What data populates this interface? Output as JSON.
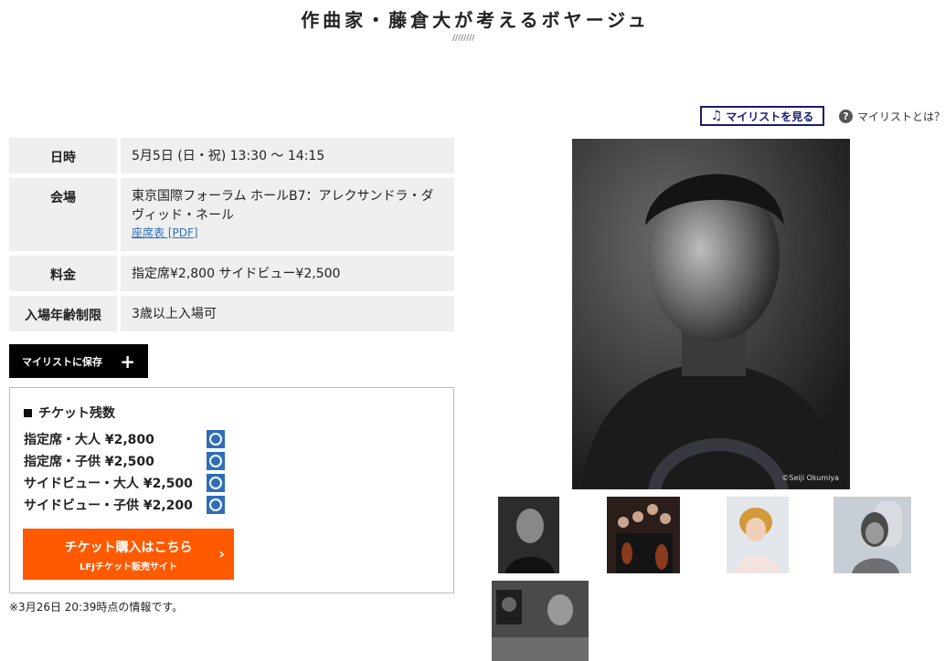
{
  "page": {
    "title": "作曲家・藤倉大が考えるボヤージュ",
    "title_deco": "////////"
  },
  "mylist": {
    "view_label": "マイリストを見る",
    "help_label": "マイリストとは？",
    "help_glyph": "?"
  },
  "info": {
    "date": {
      "label": "日時",
      "value": "5月5日 (日・祝) 13:30 〜 14:15"
    },
    "venue": {
      "label": "会場",
      "value": "東京国際フォーラム ホールB7：アレクサンドラ・ダヴィッド・ネール",
      "link": "座席表 [PDF]"
    },
    "price": {
      "label": "料金",
      "value": "指定席¥2,800 サイドビュー¥2,500"
    },
    "age": {
      "label": "入場年齢制限",
      "value": "3歳以上入場可"
    }
  },
  "save_button": {
    "label": "マイリストに保存",
    "icon": "plus-icon"
  },
  "tickets": {
    "heading": "チケット残数",
    "items": [
      {
        "name": "指定席・大人 ¥2,800"
      },
      {
        "name": "指定席・子供 ¥2,500"
      },
      {
        "name": "サイドビュー・大人 ¥2,500"
      },
      {
        "name": "サイドビュー・子供 ¥2,200"
      }
    ],
    "buy_main": "チケット購入はこちら",
    "buy_sub": "LFJチケット販売サイト",
    "buy_arrow": "›"
  },
  "note": "※3月26日 20:39時点の情報です。",
  "photo": {
    "credit": "©Seiji Okumiya"
  },
  "colors": {
    "accent_blue": "#2f6eb7",
    "buy_orange": "#ff5a00",
    "mylist_navy": "#1a1a6e",
    "cell_gray": "#efefef"
  }
}
